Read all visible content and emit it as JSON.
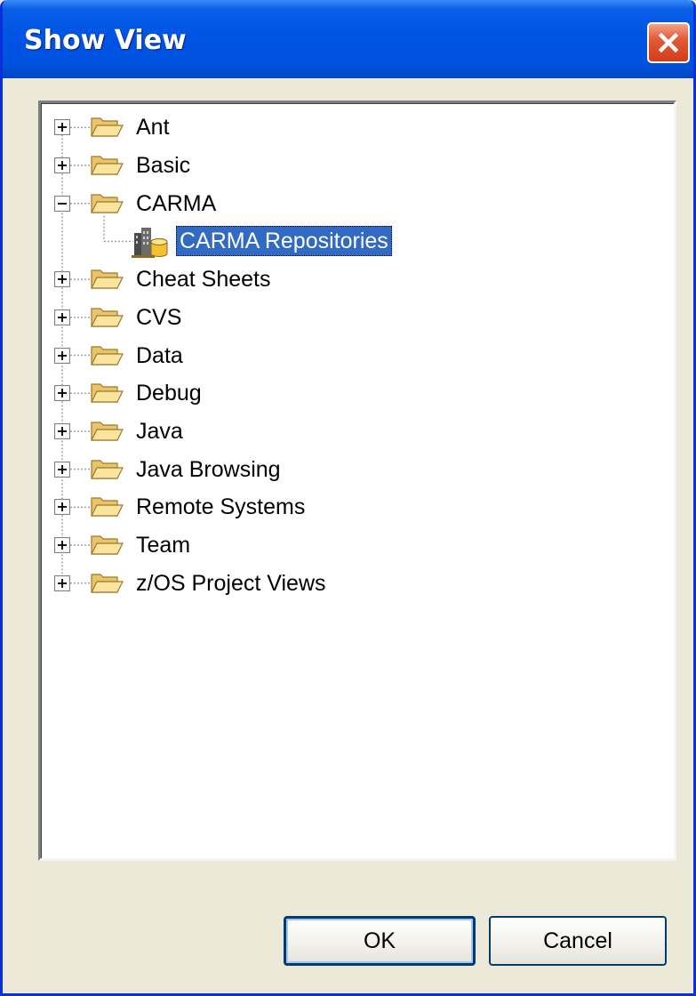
{
  "window": {
    "title": "Show View"
  },
  "tree": {
    "items": [
      {
        "label": "Ant",
        "state": "collapsed"
      },
      {
        "label": "Basic",
        "state": "collapsed"
      },
      {
        "label": "CARMA",
        "state": "expanded"
      },
      {
        "label": "CARMA Repositories",
        "state": "leaf",
        "selected": true
      },
      {
        "label": "Cheat Sheets",
        "state": "collapsed"
      },
      {
        "label": "CVS",
        "state": "collapsed"
      },
      {
        "label": "Data",
        "state": "collapsed"
      },
      {
        "label": "Debug",
        "state": "collapsed"
      },
      {
        "label": "Java",
        "state": "collapsed"
      },
      {
        "label": "Java Browsing",
        "state": "collapsed"
      },
      {
        "label": "Remote Systems",
        "state": "collapsed"
      },
      {
        "label": "Team",
        "state": "collapsed"
      },
      {
        "label": "z/OS Project Views",
        "state": "collapsed"
      }
    ]
  },
  "buttons": {
    "ok": "OK",
    "cancel": "Cancel"
  },
  "colors": {
    "titlebar": "#0054e3",
    "selection": "#316ac5",
    "dialog_bg": "#ece9d8",
    "folder": "#f5d77a"
  },
  "icons": {
    "close": "close-icon",
    "folder": "folder-open-icon",
    "repository": "repository-icon",
    "expand": "plus-box-icon",
    "collapse": "minus-box-icon"
  }
}
